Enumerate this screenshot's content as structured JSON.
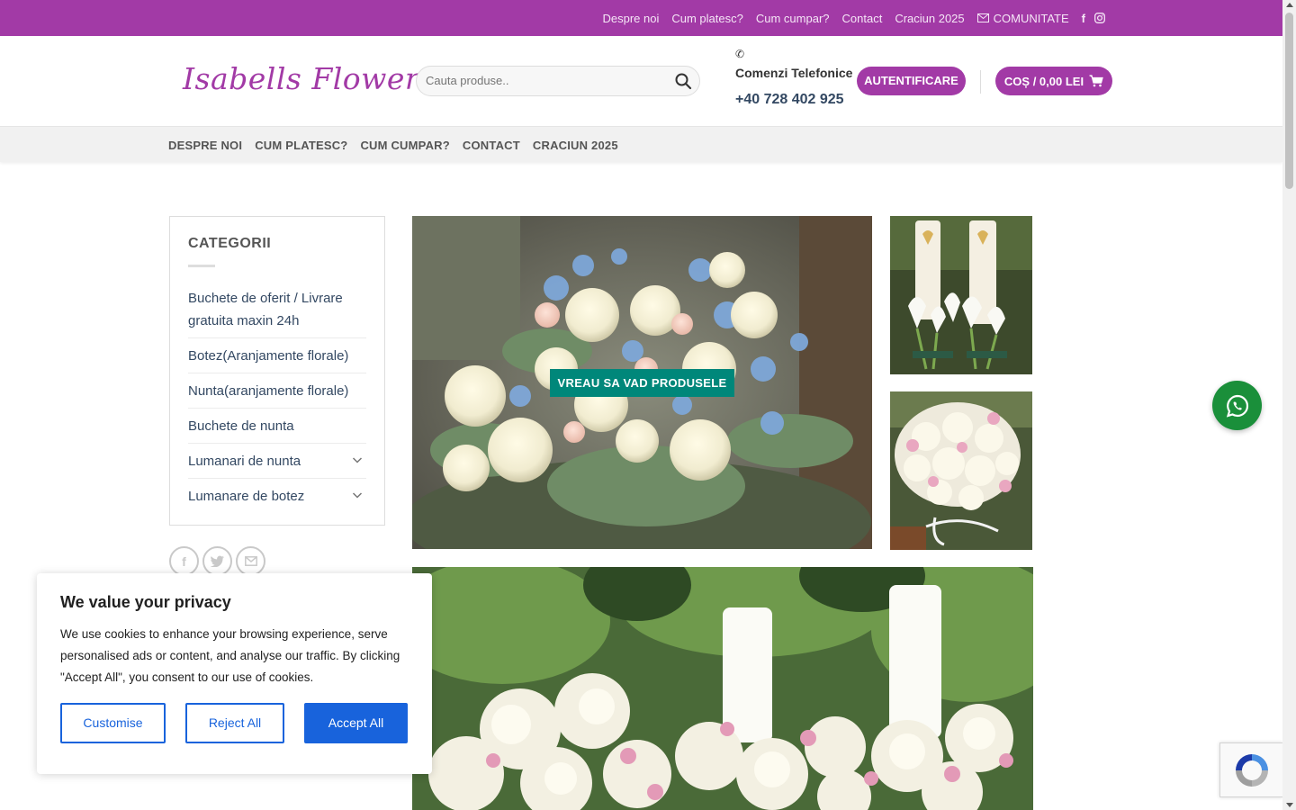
{
  "topbar": {
    "links": [
      "Despre noi",
      "Cum platesc?",
      "Cum cumpar?",
      "Contact",
      "Craciun 2025"
    ],
    "community_label": "COMUNITATE",
    "icons": [
      "mail-icon",
      "facebook-icon",
      "instagram-icon"
    ]
  },
  "header": {
    "logo_text": "Isabells Flowers",
    "search_placeholder": "Cauta produse..",
    "phone_label": "Comenzi Telefonice",
    "phone_number": "+40 728 402 925",
    "login_label": "AUTENTIFICARE",
    "cart_label": "COȘ / 0,00 LEI"
  },
  "nav": {
    "items": [
      "DESPRE NOI",
      "CUM PLATESC?",
      "CUM CUMPAR?",
      "CONTACT",
      "CRACIUN 2025"
    ]
  },
  "sidebar": {
    "title": "CATEGORII",
    "items": [
      {
        "label": "Buchete de oferit / Livrare gratuita maxin 24h",
        "expandable": false
      },
      {
        "label": "Botez(Aranjamente florale)",
        "expandable": false
      },
      {
        "label": "Nunta(aranjamente florale)",
        "expandable": false
      },
      {
        "label": "Buchete de nunta",
        "expandable": false
      },
      {
        "label": "Lumanari de nunta",
        "expandable": true
      },
      {
        "label": "Lumanare de botez",
        "expandable": true
      }
    ]
  },
  "share": {
    "icons": [
      "facebook-icon",
      "twitter-icon",
      "email-icon"
    ]
  },
  "hero": {
    "cta_label": "VREAU SA VAD PRODUSELE"
  },
  "cookie": {
    "title": "We value your privacy",
    "text": "We use cookies to enhance your browsing experience, serve personalised ads or content, and analyse our traffic. By clicking \"Accept All\", you consent to our use of cookies.",
    "customise_label": "Customise",
    "reject_label": "Reject All",
    "accept_label": "Accept All"
  },
  "colors": {
    "brand": "#a23aa6",
    "cta": "#00877a",
    "cookie_accent": "#1863dc",
    "whatsapp": "#1a8f3a"
  }
}
